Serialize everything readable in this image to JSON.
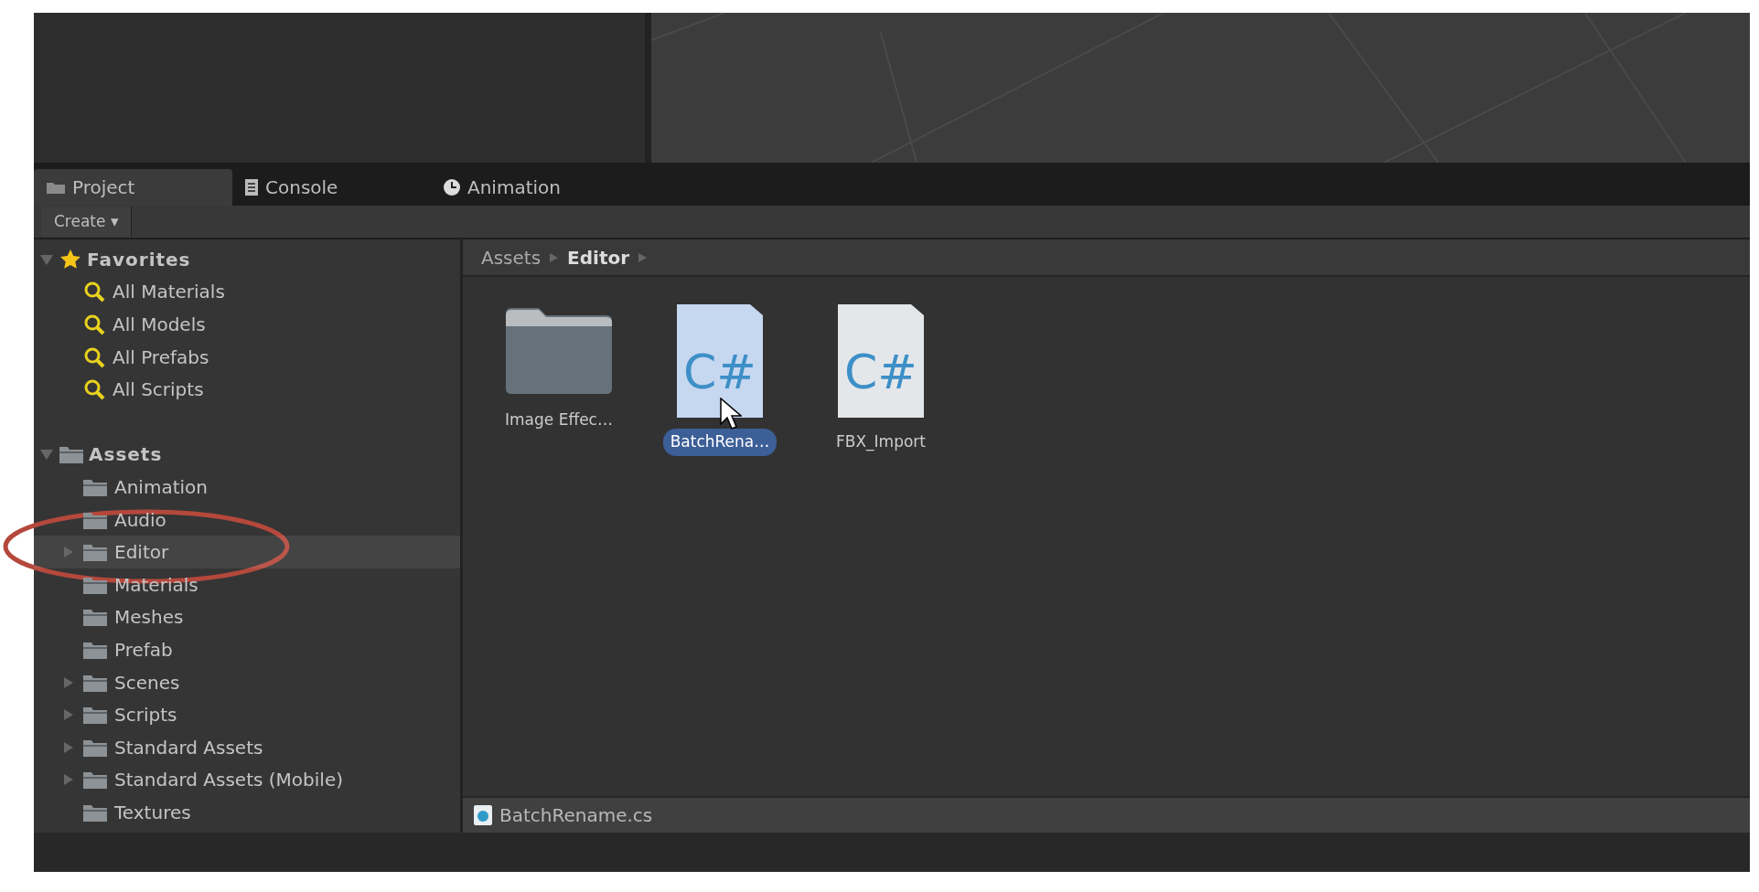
{
  "tabs": [
    {
      "label": "Project",
      "selected": true
    },
    {
      "label": "Console",
      "selected": false
    },
    {
      "label": "Animation",
      "selected": false
    }
  ],
  "toolbar": {
    "create_button": "Create",
    "caret": "▾"
  },
  "tree": [
    {
      "label": "Favorites",
      "kind": "favorites",
      "expanded": true,
      "children": [
        {
          "label": "All Materials",
          "kind": "search"
        },
        {
          "label": "All Models",
          "kind": "search"
        },
        {
          "label": "All Prefabs",
          "kind": "search"
        },
        {
          "label": "All Scripts",
          "kind": "search"
        }
      ]
    },
    {
      "label": "Assets",
      "kind": "root",
      "expanded": true,
      "children": [
        {
          "label": "Animation",
          "kind": "leaf",
          "selected": false
        },
        {
          "label": "Audio",
          "kind": "leaf",
          "selected": false
        },
        {
          "label": "Editor",
          "kind": "branch",
          "selected": true
        },
        {
          "label": "Materials",
          "kind": "leaf",
          "selected": false
        },
        {
          "label": "Meshes",
          "kind": "leaf",
          "selected": false
        },
        {
          "label": "Prefab",
          "kind": "leaf",
          "selected": false
        },
        {
          "label": "Scenes",
          "kind": "branch",
          "selected": false
        },
        {
          "label": "Scripts",
          "kind": "branch",
          "selected": false
        },
        {
          "label": "Standard Assets",
          "kind": "branch",
          "selected": false
        },
        {
          "label": "Standard Assets (Mobile)",
          "kind": "branch",
          "selected": false
        },
        {
          "label": "Textures",
          "kind": "leaf",
          "selected": false
        }
      ]
    }
  ],
  "breadcrumb": [
    {
      "label": "Assets",
      "current": false
    },
    {
      "label": "Editor",
      "current": true
    }
  ],
  "assets": [
    {
      "label": "Image Effec…",
      "kind": "folder",
      "selected": false
    },
    {
      "label": "BatchRena…",
      "kind": "script",
      "glyph": "C#",
      "selected": true
    },
    {
      "label": "FBX_Import",
      "kind": "script",
      "glyph": "C#",
      "selected": false
    }
  ],
  "file_bar": {
    "file": "BatchRename.cs"
  }
}
